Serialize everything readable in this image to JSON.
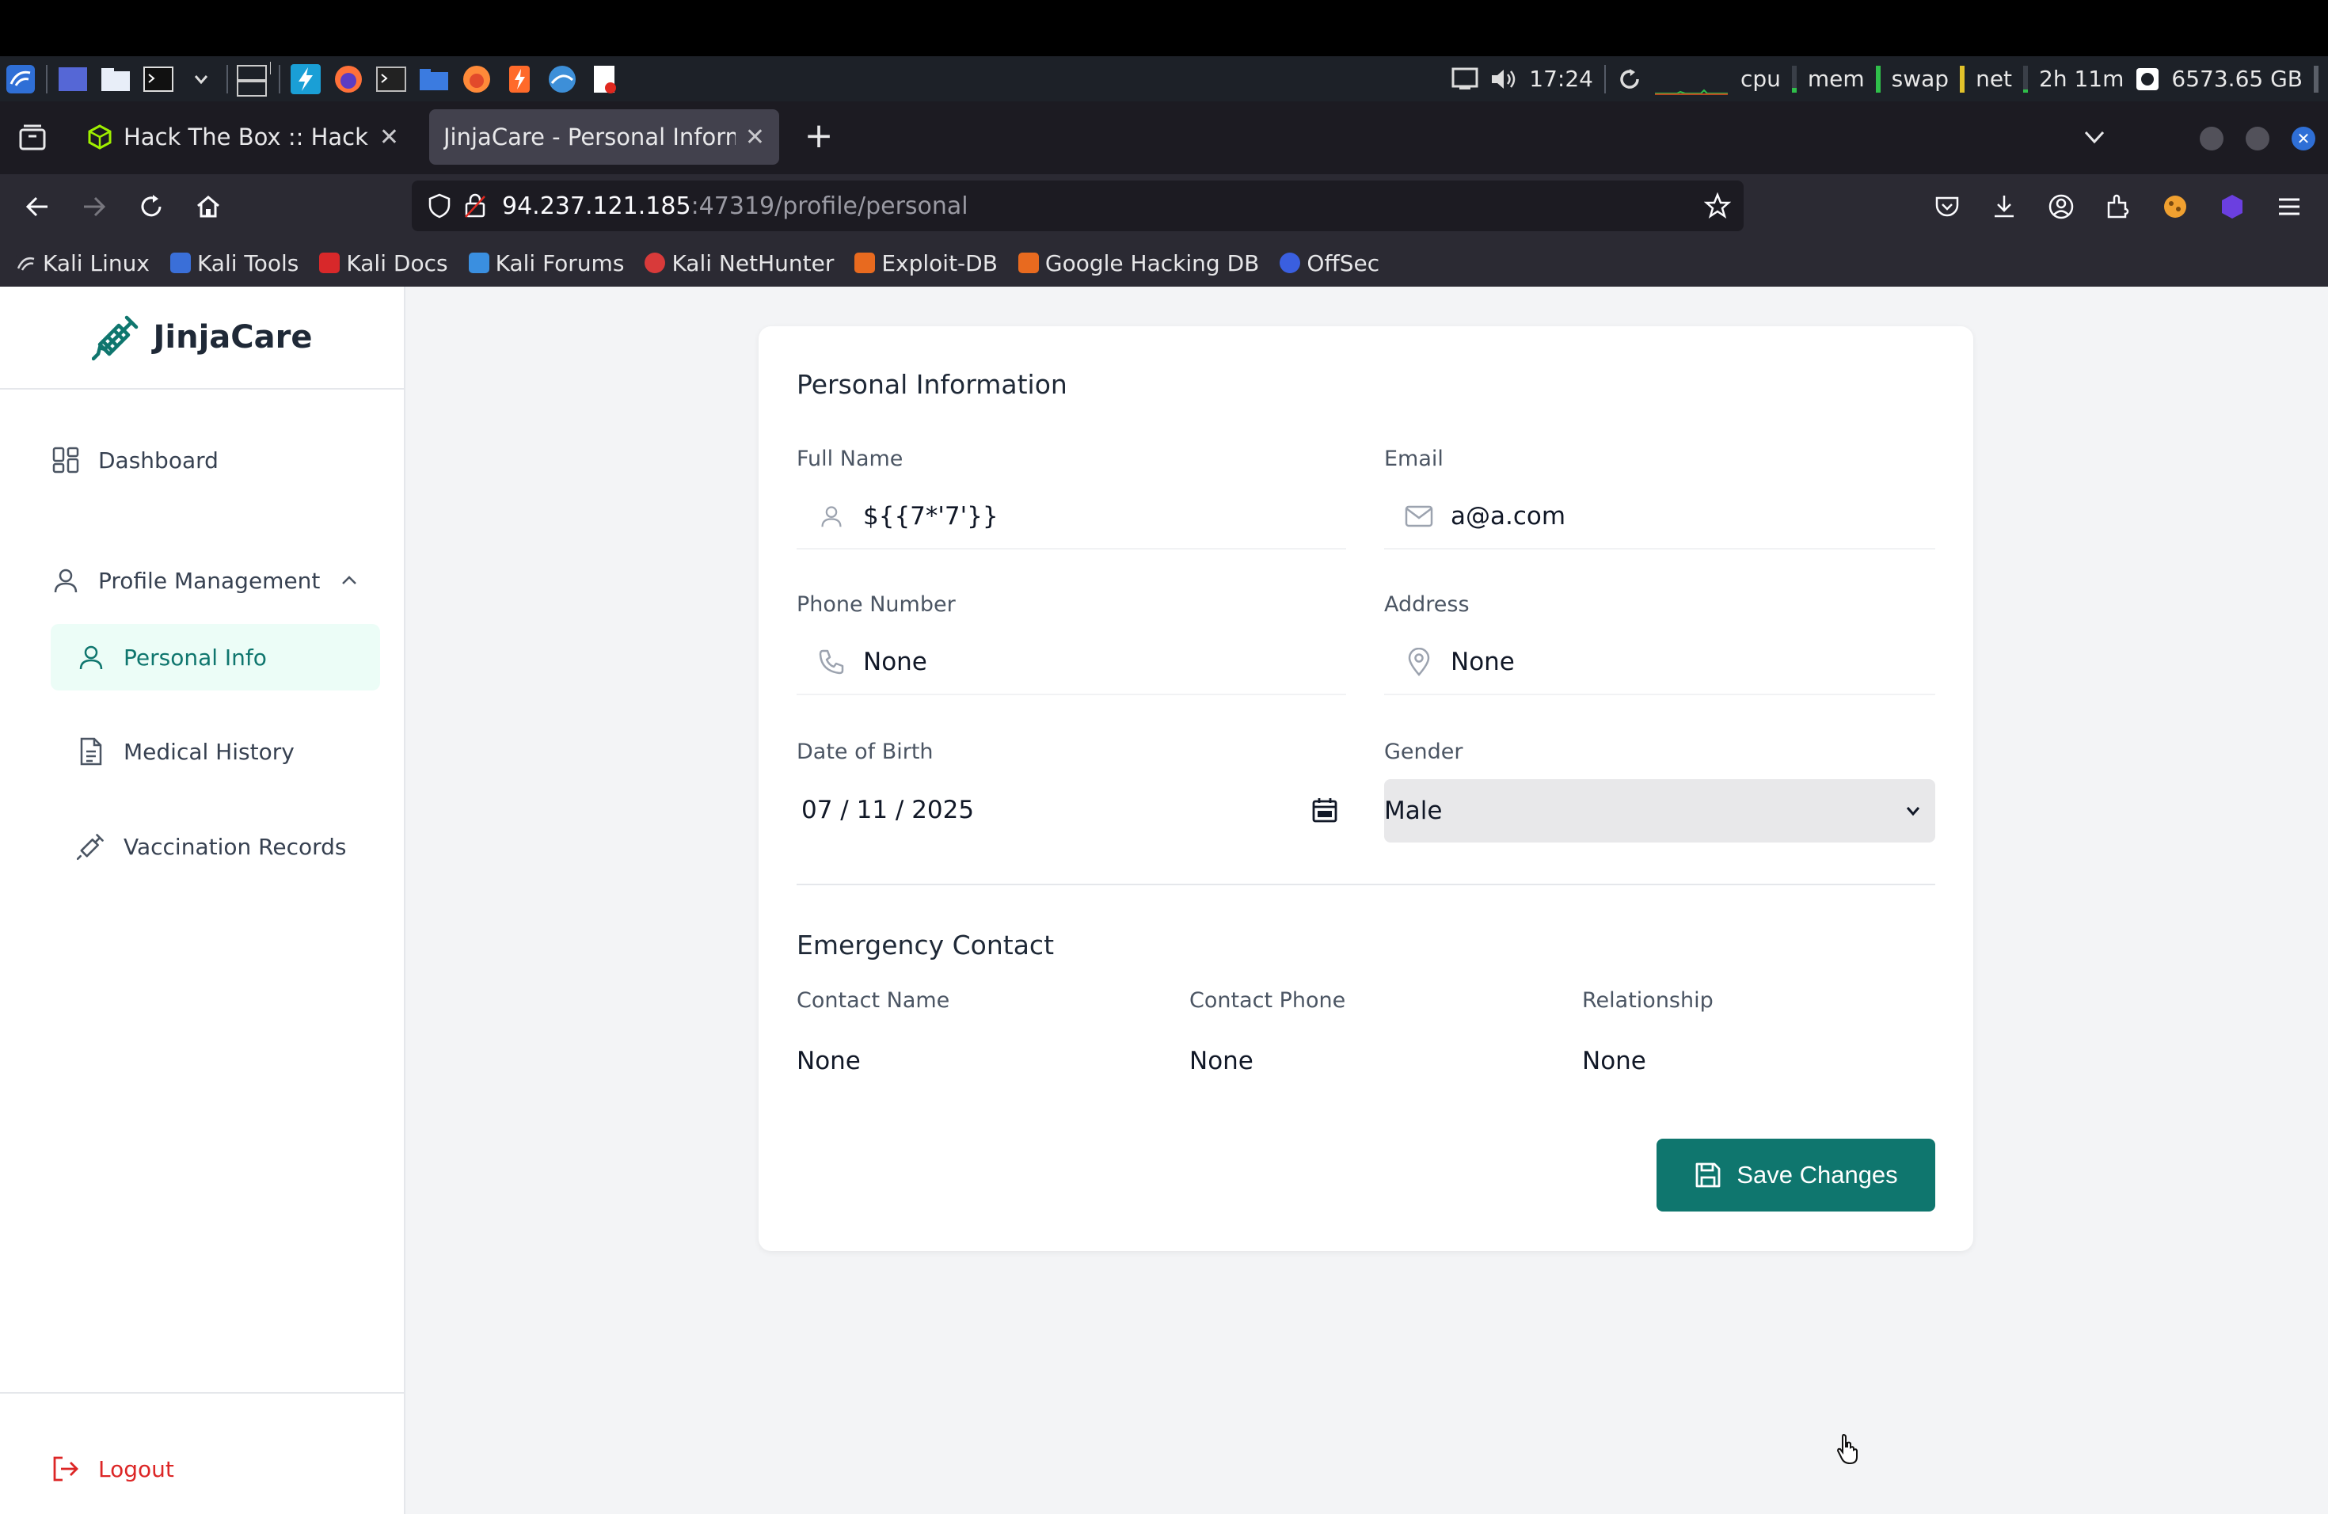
{
  "taskbar": {
    "time": "17:24",
    "cpu_label": "cpu",
    "mem_label": "mem",
    "swap_label": "swap",
    "net_label": "net",
    "uptime": "2h 11m",
    "disk": "6573.65 GB"
  },
  "browser": {
    "tabs": [
      {
        "title": "Hack The Box :: Hack The Box"
      },
      {
        "title": "JinjaCare - Personal Information"
      }
    ],
    "url_host": "94.237.121.185",
    "url_path": ":47319/profile/personal",
    "bookmarks": [
      "Kali Linux",
      "Kali Tools",
      "Kali Docs",
      "Kali Forums",
      "Kali NetHunter",
      "Exploit-DB",
      "Google Hacking DB",
      "OffSec"
    ]
  },
  "app": {
    "brand": "JinjaCare",
    "nav": {
      "dashboard": "Dashboard",
      "profile_management": "Profile Management",
      "personal_info": "Personal Info",
      "medical_history": "Medical History",
      "vaccination_records": "Vaccination Records",
      "logout": "Logout"
    },
    "colors": {
      "accent": "#0f766e",
      "logout": "#dc2626"
    }
  },
  "form": {
    "title": "Personal Information",
    "full_name": {
      "label": "Full Name",
      "value": "${{7*'7'}}"
    },
    "email": {
      "label": "Email",
      "value": "a@a.com"
    },
    "phone": {
      "label": "Phone Number",
      "value": "None"
    },
    "address": {
      "label": "Address",
      "value": "None"
    },
    "dob": {
      "label": "Date of Birth",
      "value": "07 / 11 / 2025"
    },
    "gender": {
      "label": "Gender",
      "value": "Male"
    },
    "emergency": {
      "title": "Emergency Contact",
      "contact_name": {
        "label": "Contact Name",
        "value": "None"
      },
      "contact_phone": {
        "label": "Contact Phone",
        "value": "None"
      },
      "relationship": {
        "label": "Relationship",
        "value": "None"
      }
    },
    "save_label": "Save Changes"
  }
}
